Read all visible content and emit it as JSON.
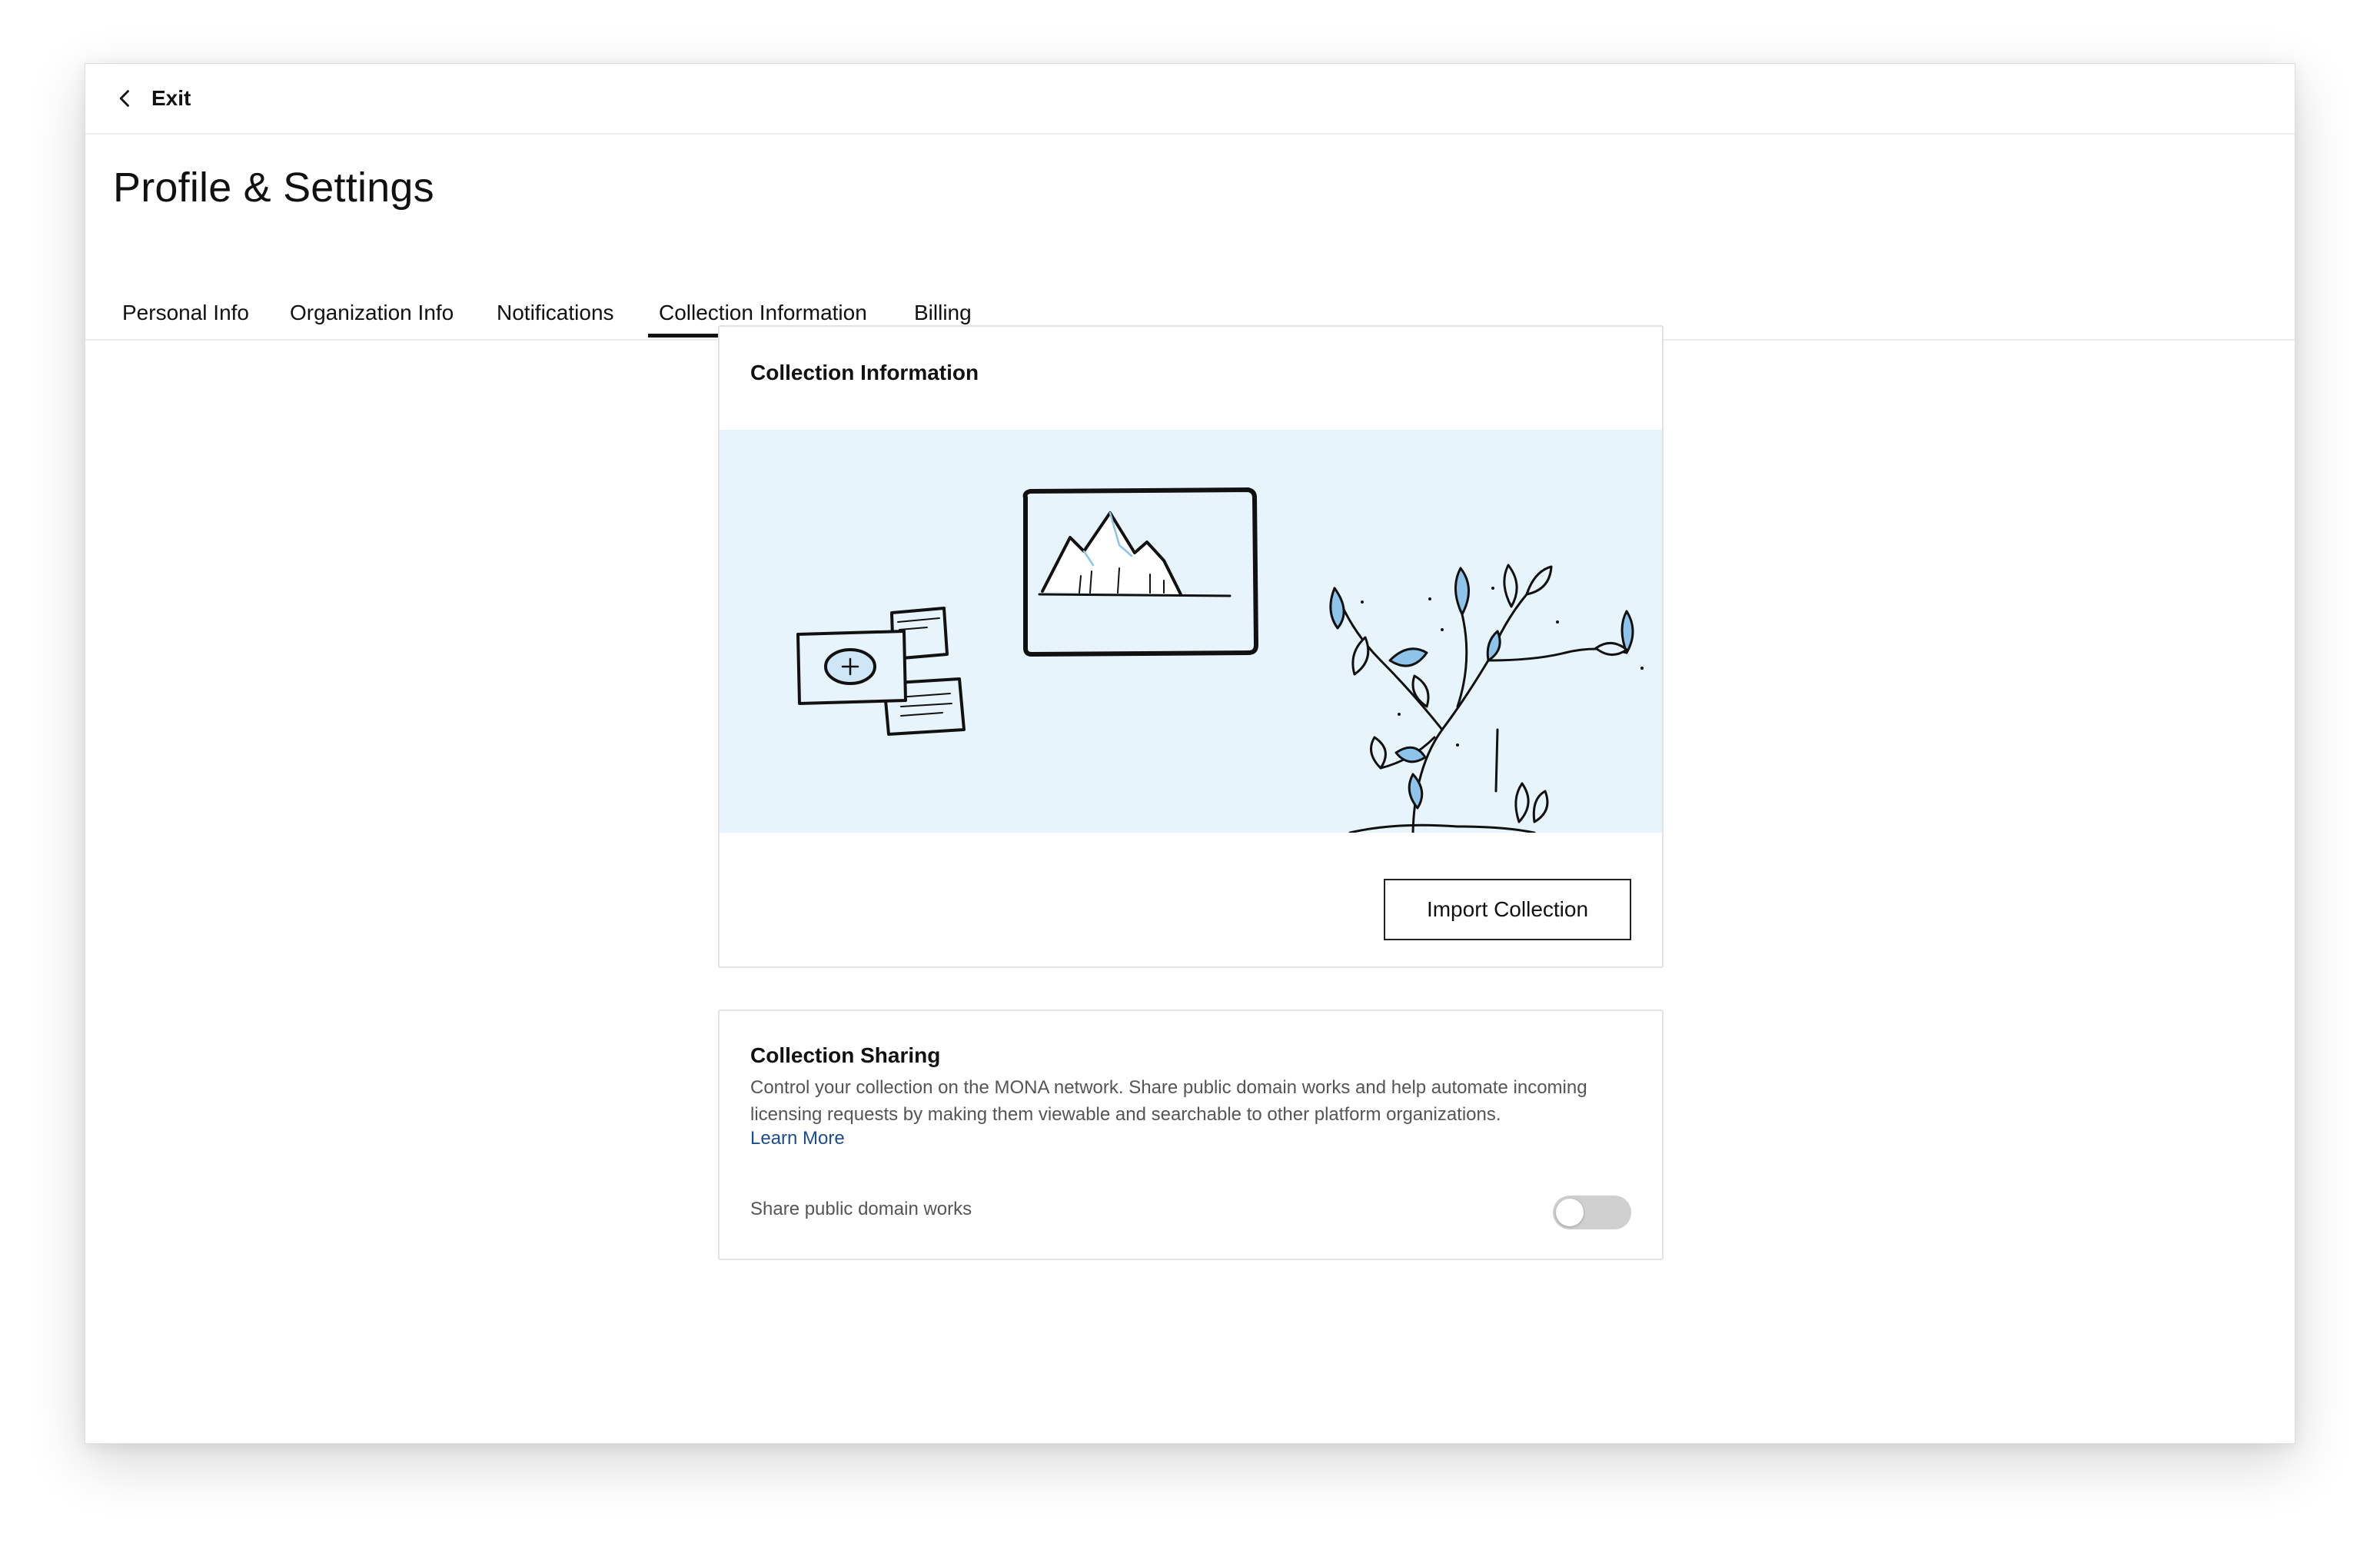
{
  "header": {
    "exit_label": "Exit",
    "exit_icon": "chevron-left-icon"
  },
  "page": {
    "title": "Profile & Settings"
  },
  "tabs": [
    {
      "label": "Personal Info",
      "active": false
    },
    {
      "label": "Organization Info",
      "active": false
    },
    {
      "label": "Notifications",
      "active": false
    },
    {
      "label": "Collection Information",
      "active": true
    },
    {
      "label": "Billing",
      "active": false
    }
  ],
  "collection_info": {
    "title": "Collection Information",
    "illustration": "gallery-illustration",
    "import_button_label": "Import Collection"
  },
  "collection_sharing": {
    "title": "Collection Sharing",
    "description": "Control your collection on the MONA network. Share public domain works and help automate incoming licensing requests by making them viewable and searchable to other platform organizations.",
    "learn_more_label": "Learn More",
    "toggle_label": "Share public domain works",
    "toggle_on": false
  },
  "colors": {
    "illustration_bg": "#e8f4fb",
    "accent_blue": "#8fc4ea",
    "link": "#1a4d8f",
    "toggle_off": "#cfcfcf"
  }
}
